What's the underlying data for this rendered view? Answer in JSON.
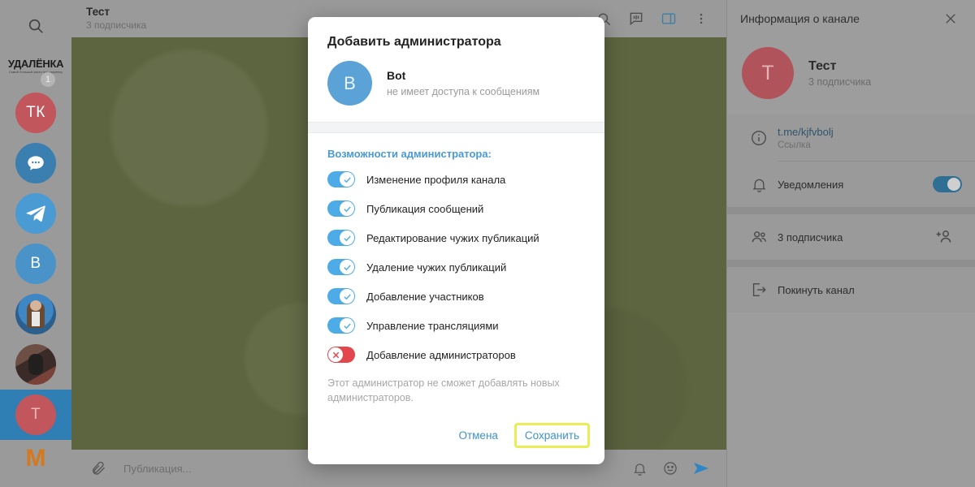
{
  "sidebar": {
    "search_icon": "search-icon",
    "items": [
      {
        "type": "logo",
        "label": "УДАЛЁНКА",
        "sublabel": "Самый большой канал про удалёнку",
        "badge": "1"
      },
      {
        "type": "avatar",
        "label": "ТК",
        "color": "#c1565c"
      },
      {
        "type": "avatar",
        "label": "",
        "icon": "chat-bubble-icon",
        "color": "#3b7fb0"
      },
      {
        "type": "avatar",
        "label": "",
        "icon": "telegram-plane-icon",
        "color": "#4a9ad4"
      },
      {
        "type": "avatar",
        "label": "В",
        "color": "#4a93c8"
      },
      {
        "type": "photo",
        "label": "",
        "color": "#6d5a46"
      },
      {
        "type": "photo",
        "label": "",
        "color": "#4a3a33"
      },
      {
        "type": "avatar",
        "label": "Т",
        "color": "#c1565c",
        "selected": true
      },
      {
        "type": "letter",
        "label": "M",
        "color": "#d4791e"
      }
    ]
  },
  "chat_header": {
    "title": "Тест",
    "subtitle": "3 подписчика",
    "icons": [
      "search-icon",
      "comments-icon",
      "right-panel-icon",
      "more-vertical-icon"
    ]
  },
  "composer": {
    "attach_icon": "paperclip-icon",
    "placeholder": "Публикация...",
    "icons": [
      "bell-icon",
      "emoji-icon",
      "send-icon"
    ]
  },
  "right_panel": {
    "title": "Информация о канале",
    "close_icon": "close-icon",
    "avatar_letter": "Т",
    "name": "Тест",
    "subscribers": "3 подписчика",
    "rows": [
      {
        "icon": "info-icon",
        "main": "t.me/kjfvbolj",
        "secondary": "Ссылка"
      },
      {
        "icon": "bell-icon",
        "label": "Уведомления",
        "toggle": "on"
      },
      {
        "icon": "members-icon",
        "label": "3 подписчика",
        "action_icon": "add-user-icon"
      },
      {
        "icon": "leave-icon",
        "label": "Покинуть канал"
      }
    ]
  },
  "modal": {
    "title": "Добавить администратора",
    "user": {
      "avatar_letter": "B",
      "name": "Bot",
      "status": "не имеет доступа к сообщениям"
    },
    "section_title": "Возможности администратора:",
    "permissions": [
      {
        "label": "Изменение профиля канала",
        "state": "on"
      },
      {
        "label": "Публикация сообщений",
        "state": "on"
      },
      {
        "label": "Редактирование чужих публикаций",
        "state": "on"
      },
      {
        "label": "Удаление чужих публикаций",
        "state": "on"
      },
      {
        "label": "Добавление участников",
        "state": "on"
      },
      {
        "label": "Управление трансляциями",
        "state": "on"
      },
      {
        "label": "Добавление администраторов",
        "state": "off"
      }
    ],
    "note": "Этот администратор не сможет добавлять новых администраторов.",
    "cancel_label": "Отмена",
    "save_label": "Сохранить"
  },
  "colors": {
    "accent": "#4dabe8",
    "danger": "#e2474e",
    "highlight": "#e8ee53",
    "chat_bg": "#5d6540"
  }
}
